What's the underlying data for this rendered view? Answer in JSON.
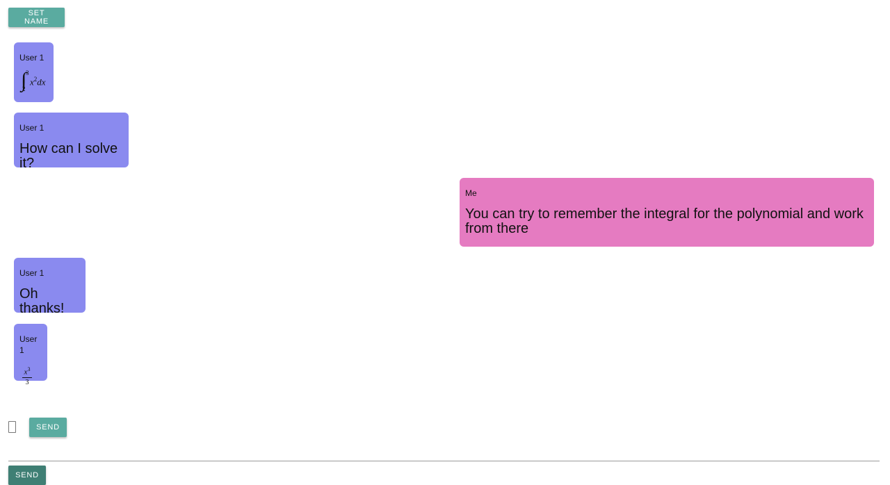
{
  "header": {
    "set_name_label": "SET NAME"
  },
  "messages": [
    {
      "sender": "User 1",
      "type": "math_integral",
      "upper": "3",
      "lower": "2",
      "base": "x",
      "exp": "2",
      "tail": "dx"
    },
    {
      "sender": "User 1",
      "type": "text",
      "text": "How can I solve it?"
    },
    {
      "sender": "Me",
      "type": "text",
      "text": "You can try to remember the integral for the polynomial and work from there"
    },
    {
      "sender": "User 1",
      "type": "text",
      "text": "Oh thanks!"
    },
    {
      "sender": "User 1",
      "type": "math_fraction",
      "num_base": "x",
      "num_exp": "3",
      "den": "3"
    }
  ],
  "composer": {
    "send_label": "SEND"
  },
  "footer": {
    "send_label": "SEND"
  },
  "colors": {
    "accent": "#5aaba0",
    "accent_dark": "#3f7f74",
    "bubble_them": "#8a8aef",
    "bubble_me": "#e57bc1"
  }
}
